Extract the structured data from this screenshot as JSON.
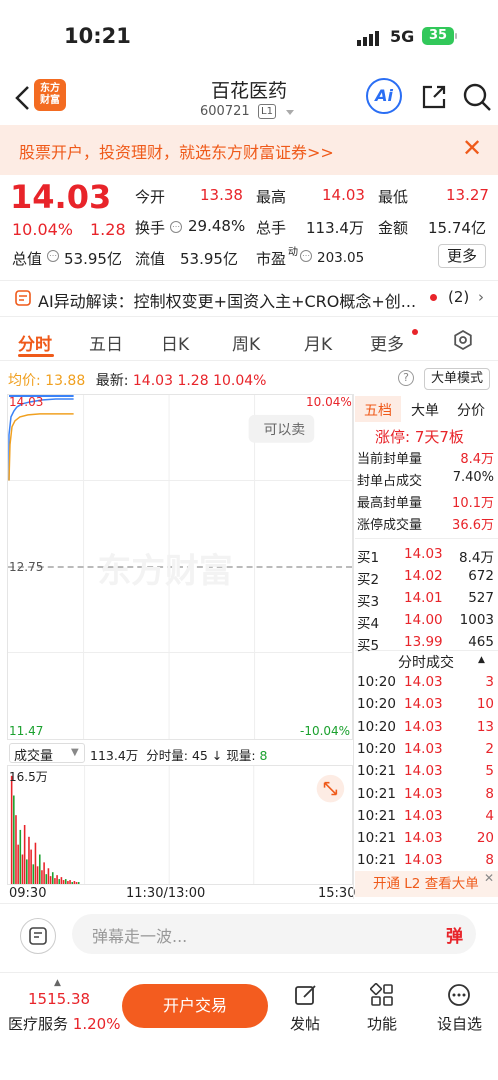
{
  "status_bar": {
    "time": "10:21",
    "network": "5G",
    "battery": "35"
  },
  "header": {
    "logo_text": "东方财富",
    "title": "百花医药",
    "code": "600721",
    "level": "L1"
  },
  "promo": {
    "text": "股票开户，投资理财，就选东方财富证券>>"
  },
  "quote": {
    "price": "14.03",
    "change_pct": "10.04%",
    "change": "1.28",
    "open_label": "今开",
    "open": "13.38",
    "high_label": "最高",
    "high": "14.03",
    "low_label": "最低",
    "low": "13.27",
    "turnover_label": "换手",
    "turnover": "29.48%",
    "volume_label": "总手",
    "volume": "113.4万",
    "amount_label": "金额",
    "amount": "15.74亿",
    "mktcap_label": "总值",
    "mktcap": "53.95亿",
    "float_label": "流值",
    "float": "53.95亿",
    "pe_label": "市盈",
    "pe_sup": "动",
    "pe": "203.05",
    "more": "更多"
  },
  "ai_bar": {
    "text": "AI异动解读：控制权变更+国资入主+CRO概念+创...",
    "count": "(2)"
  },
  "tabs": [
    {
      "label": "分时"
    },
    {
      "label": "五日"
    },
    {
      "label": "日K"
    },
    {
      "label": "周K"
    },
    {
      "label": "月K"
    },
    {
      "label": "更多"
    }
  ],
  "chart_info": {
    "avg_label": "均价:",
    "avg": "13.88",
    "latest_label": "最新:",
    "latest": "14.03",
    "chg": "1.28",
    "chg_pct": "10.04%",
    "mode": "大单模式",
    "y_top": "14.03",
    "y_top_pct": "10.04%",
    "y_mid": "12.75",
    "y_bottom": "11.47",
    "y_bottom_pct": "-10.04%",
    "sell_hint": "可以卖",
    "watermark": "东方财富"
  },
  "volume_info": {
    "selector": "成交量",
    "total": "113.4万",
    "minute_label": "分时量:",
    "minute": "45",
    "current_label": "现量:",
    "current": "8",
    "y_max": "16.5万"
  },
  "x_axis": {
    "start": "09:30",
    "mid": "11:30/13:00",
    "end": "15:30"
  },
  "side_tabs": [
    {
      "label": "五档"
    },
    {
      "label": "大单"
    },
    {
      "label": "分价"
    }
  ],
  "limit_up": {
    "title": "涨停: 7天7板",
    "rows": [
      {
        "label": "当前封单量",
        "value": "8.4万"
      },
      {
        "label": "封单占成交",
        "value": "7.40%"
      },
      {
        "label": "最高封单量",
        "value": "10.1万"
      },
      {
        "label": "涨停成交量",
        "value": "36.6万"
      }
    ]
  },
  "order_book": [
    {
      "label": "买1",
      "price": "14.03",
      "vol": "8.4万"
    },
    {
      "label": "买2",
      "price": "14.02",
      "vol": "672"
    },
    {
      "label": "买3",
      "price": "14.01",
      "vol": "527"
    },
    {
      "label": "买4",
      "price": "14.00",
      "vol": "1003"
    },
    {
      "label": "买5",
      "price": "13.99",
      "vol": "465"
    }
  ],
  "ticks_title": "分时成交",
  "ticks": [
    {
      "time": "10:20",
      "price": "14.03",
      "vol": "3"
    },
    {
      "time": "10:20",
      "price": "14.03",
      "vol": "10"
    },
    {
      "time": "10:20",
      "price": "14.03",
      "vol": "13"
    },
    {
      "time": "10:20",
      "price": "14.03",
      "vol": "2"
    },
    {
      "time": "10:21",
      "price": "14.03",
      "vol": "5"
    },
    {
      "time": "10:21",
      "price": "14.03",
      "vol": "8"
    },
    {
      "time": "10:21",
      "price": "14.03",
      "vol": "4"
    },
    {
      "time": "10:21",
      "price": "14.03",
      "vol": "20"
    },
    {
      "time": "10:21",
      "price": "14.03",
      "vol": "8"
    }
  ],
  "open_l2": "开通 L2 查看大单",
  "danmu": {
    "placeholder": "弹幕走一波...",
    "button": "弹"
  },
  "bottom_nav": {
    "index_value": "1515.38",
    "index_name": "医疗服务",
    "index_pct": "1.20%",
    "trade": "开户交易",
    "post": "发帖",
    "func": "功能",
    "custom": "设自选"
  },
  "colors": {
    "up": "#e8242a",
    "down": "#1ba12e",
    "accent": "#ef5a1a",
    "price_line": "#3b82f6",
    "avg_line": "#f0a020"
  }
}
